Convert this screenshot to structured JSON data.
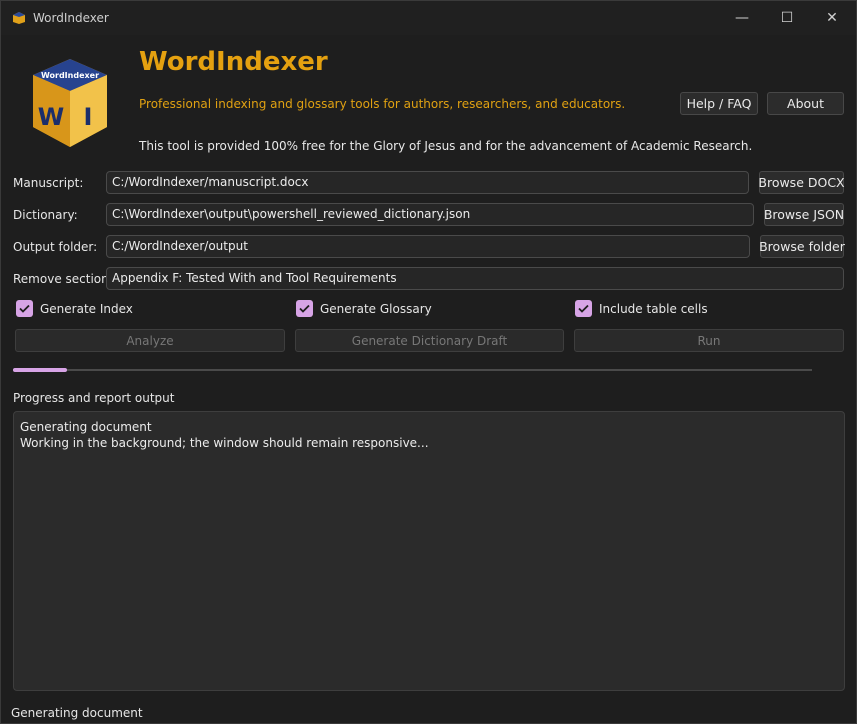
{
  "window": {
    "title": "WordIndexer",
    "controls": {
      "minimize": "—",
      "maximize": "☐",
      "close": "✕"
    }
  },
  "header": {
    "logo_text": "WordIndexer",
    "logo_letters": [
      "W",
      "I"
    ],
    "app_name": "WordIndexer",
    "tagline": "Professional indexing and glossary tools for authors, researchers, and educators.",
    "free_note": "This tool is provided 100% free for the Glory of Jesus and for the advancement of Academic Research.",
    "help_label": "Help / FAQ",
    "about_label": "About"
  },
  "form": {
    "manuscript": {
      "label": "Manuscript:",
      "value": "C:/WordIndexer/manuscript.docx",
      "browse_label": "Browse DOCX"
    },
    "dictionary": {
      "label": "Dictionary:",
      "value": "C:\\WordIndexer\\output\\powershell_reviewed_dictionary.json",
      "browse_label": "Browse JSON"
    },
    "output_folder": {
      "label": "Output folder:",
      "value": "C:/WordIndexer/output",
      "browse_label": "Browse folder"
    },
    "remove_section": {
      "label": "Remove section:",
      "value": "Appendix F: Tested With and Tool Requirements"
    }
  },
  "options": {
    "generate_index": {
      "label": "Generate Index",
      "checked": true
    },
    "generate_glossary": {
      "label": "Generate Glossary",
      "checked": true
    },
    "include_table_cells": {
      "label": "Include table cells",
      "checked": true
    }
  },
  "actions": {
    "analyze": "Analyze",
    "generate_draft": "Generate Dictionary Draft",
    "run": "Run"
  },
  "progress": {
    "fraction": 0.067
  },
  "report": {
    "label": "Progress and report output",
    "lines": [
      "Generating document",
      "Working in the background; the window should remain responsive..."
    ]
  },
  "status_bar": {
    "text": "Generating document"
  },
  "colors": {
    "accent": "#d7a4e6",
    "brand": "#e5a110",
    "background": "#1e1e1e"
  }
}
